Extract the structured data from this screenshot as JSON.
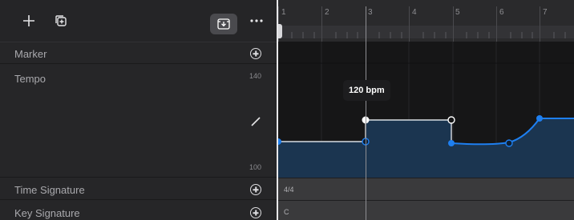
{
  "toolbar": {
    "add_icon": "plus-icon",
    "duplicate_icon": "duplicate-icon",
    "active_icon": "import-tray-icon",
    "more_icon": "more-ellipsis-icon"
  },
  "lanes": {
    "marker_label": "Marker",
    "tempo_label": "Tempo",
    "tempo_max": "140",
    "tempo_min": "100",
    "time_signature_label": "Time Signature",
    "key_signature_label": "Key Signature"
  },
  "ruler": {
    "bars": [
      "1",
      "2",
      "3",
      "4",
      "5",
      "6",
      "7"
    ]
  },
  "strips": {
    "time_signature_value": "4/4",
    "key_signature_value": "C"
  },
  "tooltip": {
    "text": "120 bpm"
  },
  "colors": {
    "accent": "#1e7ff0",
    "tempo_fill": "#1b3550",
    "line_light": "#d8dde3"
  }
}
